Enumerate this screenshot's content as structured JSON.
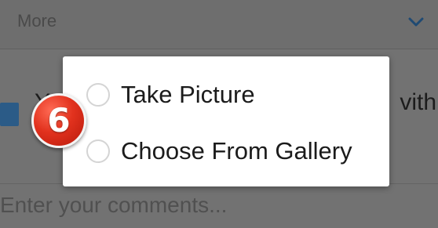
{
  "background": {
    "more_label": "More",
    "left_text": "Y",
    "right_text": "vith",
    "comments_placeholder": "Enter your comments..."
  },
  "dialog": {
    "options": [
      {
        "label": "Take Picture",
        "selected": false
      },
      {
        "label": "Choose From Gallery",
        "selected": false
      }
    ]
  },
  "step_badge": {
    "number": "6"
  },
  "icons": {
    "chevron": "chevron-down-icon"
  },
  "colors": {
    "overlay": "#727272",
    "dialog_bg": "#ffffff",
    "accent_blue": "#2b5b87",
    "badge_red": "#e2321e"
  }
}
